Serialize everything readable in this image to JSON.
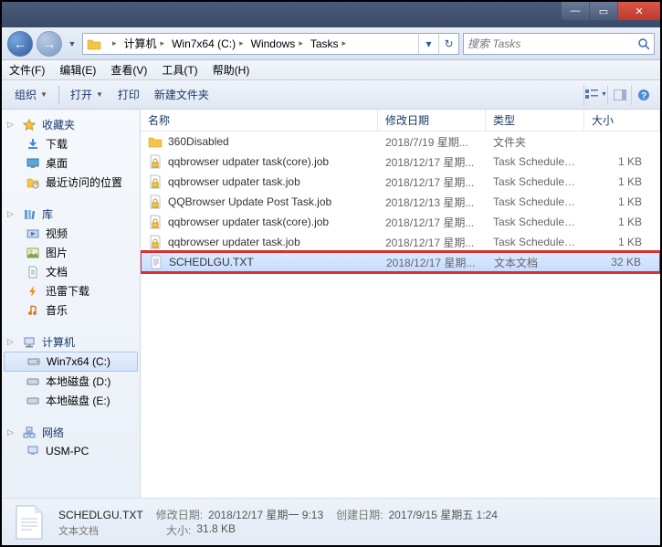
{
  "titlebar": {
    "min": "—",
    "max": "▭",
    "close": "✕"
  },
  "nav": {
    "back": "←",
    "forward": "→"
  },
  "breadcrumbs": [
    {
      "label": "计算机"
    },
    {
      "label": "Win7x64 (C:)"
    },
    {
      "label": "Windows"
    },
    {
      "label": "Tasks"
    }
  ],
  "search": {
    "placeholder": "搜索 Tasks"
  },
  "menu": {
    "file": "文件(F)",
    "edit": "编辑(E)",
    "view": "查看(V)",
    "tools": "工具(T)",
    "help": "帮助(H)"
  },
  "toolbar": {
    "organize": "组织",
    "open": "打开",
    "print": "打印",
    "newfolder": "新建文件夹"
  },
  "columns": {
    "name": "名称",
    "date": "修改日期",
    "type": "类型",
    "size": "大小"
  },
  "sidebar": {
    "favorites": {
      "label": "收藏夹",
      "items": [
        {
          "label": "下载",
          "icon": "download"
        },
        {
          "label": "桌面",
          "icon": "desktop"
        },
        {
          "label": "最近访问的位置",
          "icon": "recent"
        }
      ]
    },
    "libraries": {
      "label": "库",
      "items": [
        {
          "label": "视频",
          "icon": "video"
        },
        {
          "label": "图片",
          "icon": "picture"
        },
        {
          "label": "文档",
          "icon": "document"
        },
        {
          "label": "迅雷下载",
          "icon": "thunder"
        },
        {
          "label": "音乐",
          "icon": "music"
        }
      ]
    },
    "computer": {
      "label": "计算机",
      "items": [
        {
          "label": "Win7x64 (C:)",
          "icon": "disk",
          "selected": true
        },
        {
          "label": "本地磁盘 (D:)",
          "icon": "disk"
        },
        {
          "label": "本地磁盘 (E:)",
          "icon": "disk"
        }
      ]
    },
    "network": {
      "label": "网络",
      "items": [
        {
          "label": "USM-PC",
          "icon": "pc"
        }
      ]
    }
  },
  "files": [
    {
      "name": "360Disabled",
      "date": "2018/7/19 星期...",
      "type": "文件夹",
      "size": "",
      "icon": "folder"
    },
    {
      "name": "qqbrowser udpater task(core).job",
      "date": "2018/12/17 星期...",
      "type": "Task Scheduler ...",
      "size": "1 KB",
      "icon": "job-lock"
    },
    {
      "name": "qqbrowser udpater task.job",
      "date": "2018/12/17 星期...",
      "type": "Task Scheduler ...",
      "size": "1 KB",
      "icon": "job-lock"
    },
    {
      "name": "QQBrowser Update Post Task.job",
      "date": "2018/12/13 星期...",
      "type": "Task Scheduler ...",
      "size": "1 KB",
      "icon": "job-lock"
    },
    {
      "name": "qqbrowser updater task(core).job",
      "date": "2018/12/17 星期...",
      "type": "Task Scheduler ...",
      "size": "1 KB",
      "icon": "job-lock"
    },
    {
      "name": "qqbrowser updater task.job",
      "date": "2018/12/17 星期...",
      "type": "Task Scheduler ...",
      "size": "1 KB",
      "icon": "job-lock"
    },
    {
      "name": "SCHEDLGU.TXT",
      "date": "2018/12/17 星期...",
      "type": "文本文档",
      "size": "32 KB",
      "icon": "txt",
      "selected": true,
      "highlighted": true
    }
  ],
  "details": {
    "filename": "SCHEDLGU.TXT",
    "filetype": "文本文档",
    "mod_label": "修改日期:",
    "mod_value": "2018/12/17 星期一 9:13",
    "create_label": "创建日期:",
    "create_value": "2017/9/15 星期五 1:24",
    "size_label": "大小:",
    "size_value": "31.8 KB"
  }
}
